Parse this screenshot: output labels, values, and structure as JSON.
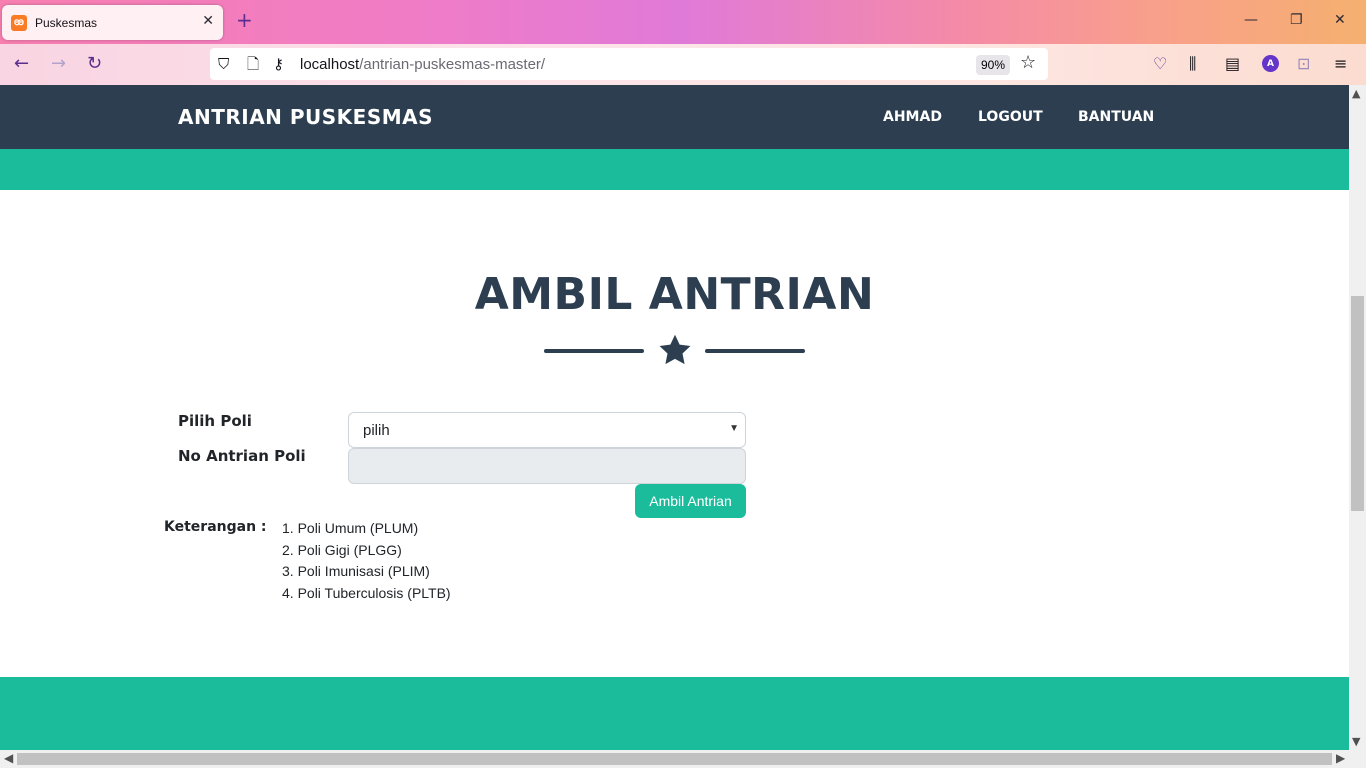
{
  "browser": {
    "tab_title": "Puskesmas",
    "favicon_glyph": "ꙭ",
    "url_host": "localhost",
    "url_path": "/antrian-puskesmas-master/",
    "zoom": "90%",
    "profile_initial": "A"
  },
  "site": {
    "brand": "ANTRIAN PUSKESMAS",
    "nav": [
      "AHMAD",
      "LOGOUT",
      "BANTUAN"
    ],
    "colors": {
      "navbar": "#2c3e50",
      "accent": "#1abc9c"
    }
  },
  "main": {
    "heading": "AMBIL ANTRIAN",
    "form": {
      "poli_label": "Pilih Poli",
      "poli_selected": "pilih",
      "no_antrian_label": "No Antrian Poli",
      "no_antrian_value": "",
      "submit_label": "Ambil Antrian"
    },
    "keterangan": {
      "label": "Keterangan :",
      "items": [
        "1. Poli Umum (PLUM)",
        "2. Poli Gigi (PLGG)",
        "3. Poli Imunisasi (PLIM)",
        "4. Poli Tuberculosis (PLTB)"
      ]
    }
  }
}
